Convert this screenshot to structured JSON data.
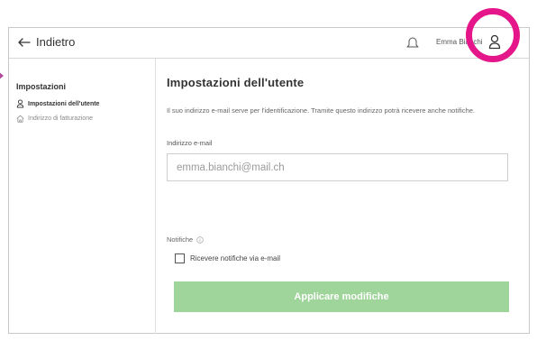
{
  "header": {
    "back_label": "Indietro",
    "username": "Emma Bianchi"
  },
  "sidebar": {
    "title": "Impostazioni",
    "items": [
      {
        "label": "Impostazioni dell'utente",
        "active": true,
        "icon": "user-icon"
      },
      {
        "label": "Indirizzo di fatturazione",
        "active": false,
        "icon": "home-icon"
      }
    ]
  },
  "main": {
    "title": "Impostazioni dell'utente",
    "description": "Il suo indirizzo e-mail serve per l'identificazione. Tramite questo indirizzo potrà ricevere anche notifiche.",
    "email_label": "Indirizzo e-mail",
    "email_value": "emma.bianchi@mail.ch",
    "notifications_label": "Notifiche",
    "checkbox_label": "Ricevere notifiche via e-mail",
    "checkbox_checked": false,
    "apply_label": "Applicare modifiche"
  },
  "colors": {
    "apply_button": "#9fd49a",
    "highlight_ring": "#e5168a"
  }
}
